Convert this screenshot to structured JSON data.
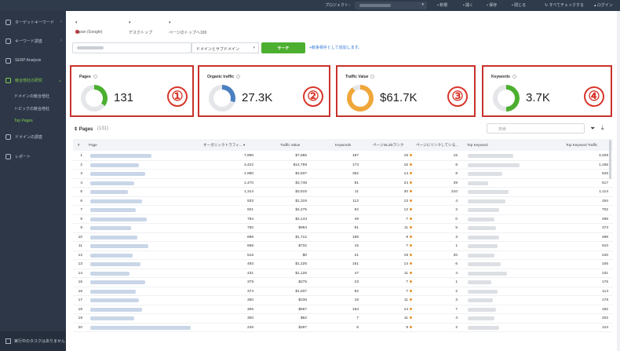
{
  "topbar": {
    "project_label": "プロジェクト：",
    "items": [
      "新規",
      "開く",
      "保存",
      "閉じる",
      "すべてチェックする",
      "ログイン"
    ]
  },
  "sidebar": {
    "items": [
      {
        "label": "ターゲットキーワード",
        "icon": "list-icon"
      },
      {
        "label": "キーワード調査",
        "icon": "search-icon"
      },
      {
        "label": "SERP Analysis",
        "icon": "chart-icon"
      },
      {
        "label": "競合他社の研究",
        "icon": "competitor-icon",
        "active": true
      },
      {
        "label": "ドメインの調査",
        "icon": "globe-icon"
      },
      {
        "label": "レポート",
        "icon": "report-icon"
      }
    ],
    "subitems": [
      "ドメインの競合他社",
      "トピックの競合他社",
      "Top Pages"
    ],
    "selected_sub": "Top Pages",
    "task_label": "実行中のタスクはありません"
  },
  "filters": {
    "locale": "Japan (Google)",
    "device": "デスクトップ",
    "scope": "ページのトップへ100"
  },
  "search": {
    "mode": "ドメインとサブドメイン",
    "button": "サーチ",
    "add_link": "+競争相手として追加します。"
  },
  "cards": [
    {
      "label": "Pages",
      "value": "131",
      "badge": "①",
      "color": "#4caf2f",
      "fill": 0.35
    },
    {
      "label": "Organic traffic",
      "value": "27.3K",
      "badge": "②",
      "color": "#4a7fc1",
      "fill": 0.3
    },
    {
      "label": "Traffic Value",
      "value": "$61.7K",
      "badge": "③",
      "color": "#f0a73a",
      "fill": 0.9
    },
    {
      "label": "Keywords",
      "value": "3.7K",
      "badge": "④",
      "color": "#4caf2f",
      "fill": 0.5
    }
  ],
  "pages": {
    "title": "Pages",
    "count": "(131)",
    "filter_placeholder": "検索"
  },
  "table": {
    "headers": [
      "#",
      "Page",
      "オーガニックトラフィ...",
      "Traffic Value",
      "Keywords",
      "ページinLinkランク",
      "ページにリンクしている...",
      "Top Keyword",
      "Top Keyword Traffic"
    ],
    "rows": [
      {
        "n": "1",
        "traffic": "7,990",
        "value": "$7,965",
        "kw": "187",
        "rank": "18",
        "links": "15",
        "top_traffic": "3,409"
      },
      {
        "n": "2",
        "traffic": "3,422",
        "value": "$14,759",
        "kw": "173",
        "rank": "15",
        "links": "8",
        "top_traffic": "1,166"
      },
      {
        "n": "3",
        "traffic": "1,980",
        "value": "$4,837",
        "kw": "352",
        "rank": "14",
        "links": "8",
        "top_traffic": "526"
      },
      {
        "n": "4",
        "traffic": "1,470",
        "value": "$3,748",
        "kw": "81",
        "rank": "24",
        "links": "39",
        "top_traffic": "517"
      },
      {
        "n": "5",
        "traffic": "1,314",
        "value": "$3,815",
        "kw": "11",
        "rank": "30",
        "links": "210",
        "top_traffic": "1,114"
      },
      {
        "n": "6",
        "traffic": "933",
        "value": "$1,319",
        "kw": "112",
        "rank": "13",
        "links": "4",
        "top_traffic": "194"
      },
      {
        "n": "7",
        "traffic": "921",
        "value": "$4,275",
        "kw": "62",
        "rank": "12",
        "links": "2",
        "top_traffic": "702"
      },
      {
        "n": "8",
        "traffic": "784",
        "value": "$2,144",
        "kw": "49",
        "rank": "7",
        "links": "0",
        "top_traffic": "486"
      },
      {
        "n": "9",
        "traffic": "750",
        "value": "$984",
        "kw": "81",
        "rank": "11",
        "links": "5",
        "top_traffic": "373"
      },
      {
        "n": "10",
        "traffic": "696",
        "value": "$1,712",
        "kw": "189",
        "rank": "9",
        "links": "3",
        "top_traffic": "488"
      },
      {
        "n": "11",
        "traffic": "668",
        "value": "$732",
        "kw": "15",
        "rank": "7",
        "links": "1",
        "top_traffic": "610"
      },
      {
        "n": "12",
        "traffic": "516",
        "value": "$0",
        "kw": "21",
        "rank": "19",
        "links": "20",
        "top_traffic": "240"
      },
      {
        "n": "13",
        "traffic": "493",
        "value": "$1,225",
        "kw": "151",
        "rank": "14",
        "links": "6",
        "top_traffic": "105"
      },
      {
        "n": "14",
        "traffic": "431",
        "value": "$1,126",
        "kw": "47",
        "rank": "11",
        "links": "4",
        "top_traffic": "231"
      },
      {
        "n": "15",
        "traffic": "379",
        "value": "$275",
        "kw": "23",
        "rank": "7",
        "links": "1",
        "top_traffic": "176"
      },
      {
        "n": "16",
        "traffic": "374",
        "value": "$1,937",
        "kw": "82",
        "rank": "7",
        "links": "2",
        "top_traffic": "114"
      },
      {
        "n": "17",
        "traffic": "350",
        "value": "$236",
        "kw": "18",
        "rank": "11",
        "links": "3",
        "top_traffic": "178"
      },
      {
        "n": "18",
        "traffic": "306",
        "value": "$597",
        "kw": "153",
        "rank": "14",
        "links": "7",
        "top_traffic": "182"
      },
      {
        "n": "19",
        "traffic": "300",
        "value": "$62",
        "kw": "7",
        "rank": "11",
        "links": "4",
        "top_traffic": "202"
      },
      {
        "n": "20",
        "traffic": "226",
        "value": "$297",
        "kw": "6",
        "rank": "9",
        "links": "2",
        "top_traffic": "124"
      }
    ]
  }
}
